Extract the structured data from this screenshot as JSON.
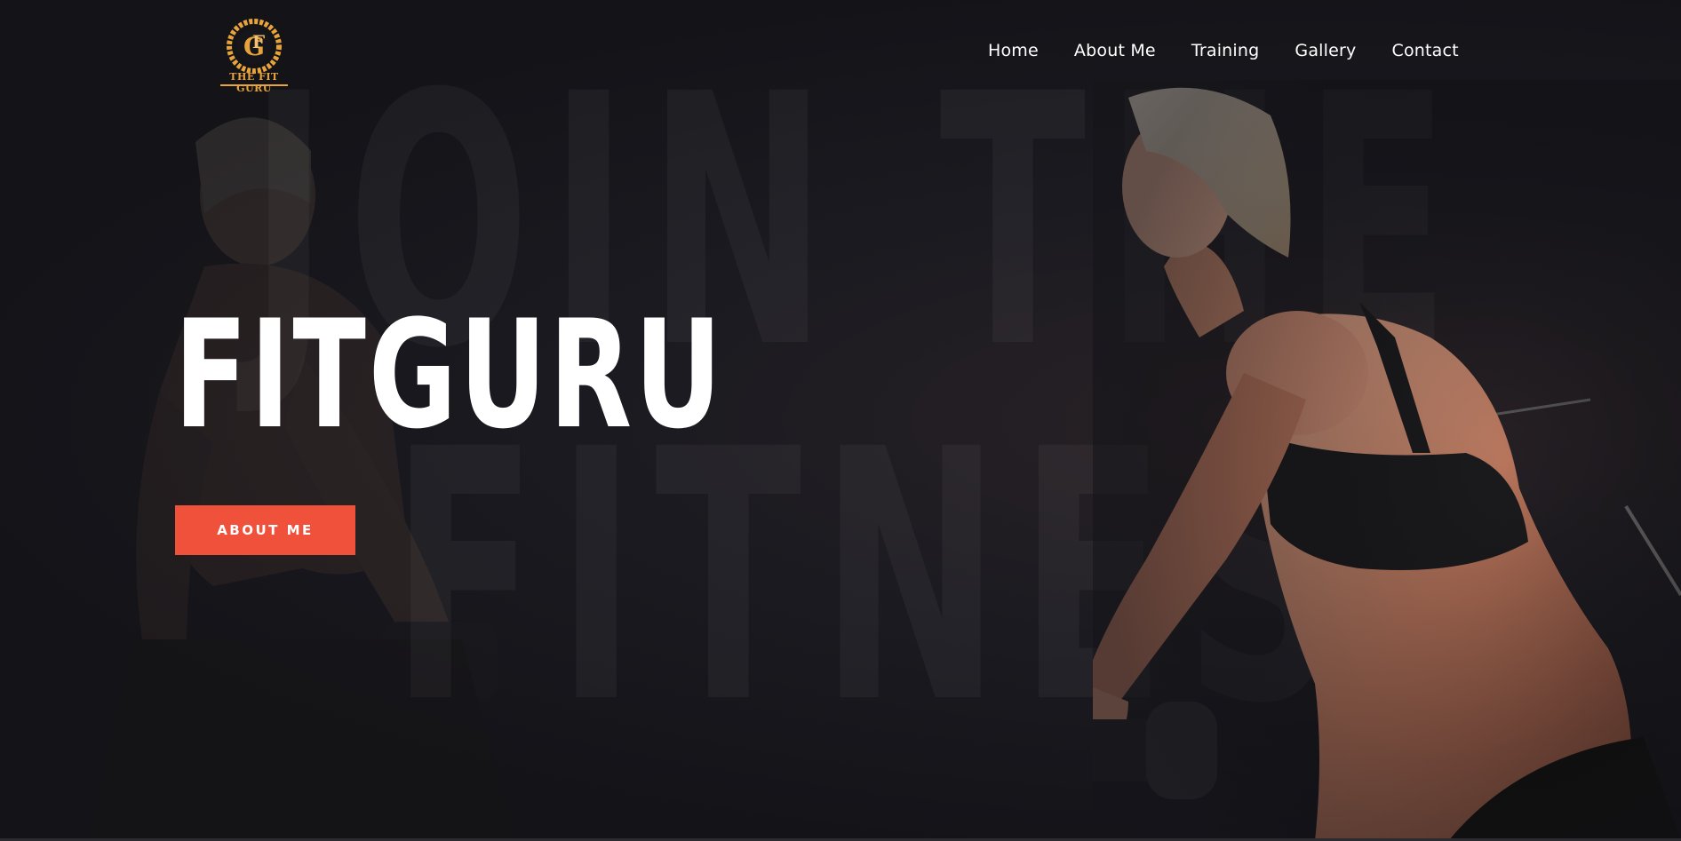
{
  "brand": {
    "logo_letters": "FG",
    "logo_caption": "THE FIT GURU"
  },
  "nav": {
    "items": [
      {
        "label": "Home"
      },
      {
        "label": "About Me"
      },
      {
        "label": "Training"
      },
      {
        "label": "Gallery"
      },
      {
        "label": "Contact"
      }
    ]
  },
  "hero": {
    "background_line_1": "JOIN THE",
    "background_line_2": "FITNESS",
    "title": "FITGURU",
    "cta_label": "ABOUT ME"
  },
  "colors": {
    "accent": "#f0513b",
    "logo_gold": "#e8a43a",
    "background": "#15151a"
  },
  "icons": {
    "logo": "fitguru-logo-icon"
  }
}
